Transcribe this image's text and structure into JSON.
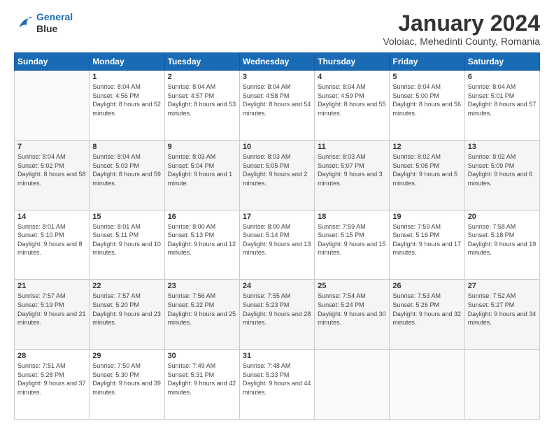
{
  "logo": {
    "line1": "General",
    "line2": "Blue"
  },
  "title": "January 2024",
  "location": "Voloiac, Mehedinti County, Romania",
  "days_header": [
    "Sunday",
    "Monday",
    "Tuesday",
    "Wednesday",
    "Thursday",
    "Friday",
    "Saturday"
  ],
  "weeks": [
    [
      {
        "num": "",
        "sunrise": "",
        "sunset": "",
        "daylight": ""
      },
      {
        "num": "1",
        "sunrise": "Sunrise: 8:04 AM",
        "sunset": "Sunset: 4:56 PM",
        "daylight": "Daylight: 8 hours and 52 minutes."
      },
      {
        "num": "2",
        "sunrise": "Sunrise: 8:04 AM",
        "sunset": "Sunset: 4:57 PM",
        "daylight": "Daylight: 8 hours and 53 minutes."
      },
      {
        "num": "3",
        "sunrise": "Sunrise: 8:04 AM",
        "sunset": "Sunset: 4:58 PM",
        "daylight": "Daylight: 8 hours and 54 minutes."
      },
      {
        "num": "4",
        "sunrise": "Sunrise: 8:04 AM",
        "sunset": "Sunset: 4:59 PM",
        "daylight": "Daylight: 8 hours and 55 minutes."
      },
      {
        "num": "5",
        "sunrise": "Sunrise: 8:04 AM",
        "sunset": "Sunset: 5:00 PM",
        "daylight": "Daylight: 8 hours and 56 minutes."
      },
      {
        "num": "6",
        "sunrise": "Sunrise: 8:04 AM",
        "sunset": "Sunset: 5:01 PM",
        "daylight": "Daylight: 8 hours and 57 minutes."
      }
    ],
    [
      {
        "num": "7",
        "sunrise": "Sunrise: 8:04 AM",
        "sunset": "Sunset: 5:02 PM",
        "daylight": "Daylight: 8 hours and 58 minutes."
      },
      {
        "num": "8",
        "sunrise": "Sunrise: 8:04 AM",
        "sunset": "Sunset: 5:03 PM",
        "daylight": "Daylight: 8 hours and 59 minutes."
      },
      {
        "num": "9",
        "sunrise": "Sunrise: 8:03 AM",
        "sunset": "Sunset: 5:04 PM",
        "daylight": "Daylight: 9 hours and 1 minute."
      },
      {
        "num": "10",
        "sunrise": "Sunrise: 8:03 AM",
        "sunset": "Sunset: 5:05 PM",
        "daylight": "Daylight: 9 hours and 2 minutes."
      },
      {
        "num": "11",
        "sunrise": "Sunrise: 8:03 AM",
        "sunset": "Sunset: 5:07 PM",
        "daylight": "Daylight: 9 hours and 3 minutes."
      },
      {
        "num": "12",
        "sunrise": "Sunrise: 8:02 AM",
        "sunset": "Sunset: 5:08 PM",
        "daylight": "Daylight: 9 hours and 5 minutes."
      },
      {
        "num": "13",
        "sunrise": "Sunrise: 8:02 AM",
        "sunset": "Sunset: 5:09 PM",
        "daylight": "Daylight: 9 hours and 6 minutes."
      }
    ],
    [
      {
        "num": "14",
        "sunrise": "Sunrise: 8:01 AM",
        "sunset": "Sunset: 5:10 PM",
        "daylight": "Daylight: 9 hours and 8 minutes."
      },
      {
        "num": "15",
        "sunrise": "Sunrise: 8:01 AM",
        "sunset": "Sunset: 5:11 PM",
        "daylight": "Daylight: 9 hours and 10 minutes."
      },
      {
        "num": "16",
        "sunrise": "Sunrise: 8:00 AM",
        "sunset": "Sunset: 5:13 PM",
        "daylight": "Daylight: 9 hours and 12 minutes."
      },
      {
        "num": "17",
        "sunrise": "Sunrise: 8:00 AM",
        "sunset": "Sunset: 5:14 PM",
        "daylight": "Daylight: 9 hours and 13 minutes."
      },
      {
        "num": "18",
        "sunrise": "Sunrise: 7:59 AM",
        "sunset": "Sunset: 5:15 PM",
        "daylight": "Daylight: 9 hours and 15 minutes."
      },
      {
        "num": "19",
        "sunrise": "Sunrise: 7:59 AM",
        "sunset": "Sunset: 5:16 PM",
        "daylight": "Daylight: 9 hours and 17 minutes."
      },
      {
        "num": "20",
        "sunrise": "Sunrise: 7:58 AM",
        "sunset": "Sunset: 5:18 PM",
        "daylight": "Daylight: 9 hours and 19 minutes."
      }
    ],
    [
      {
        "num": "21",
        "sunrise": "Sunrise: 7:57 AM",
        "sunset": "Sunset: 5:19 PM",
        "daylight": "Daylight: 9 hours and 21 minutes."
      },
      {
        "num": "22",
        "sunrise": "Sunrise: 7:57 AM",
        "sunset": "Sunset: 5:20 PM",
        "daylight": "Daylight: 9 hours and 23 minutes."
      },
      {
        "num": "23",
        "sunrise": "Sunrise: 7:56 AM",
        "sunset": "Sunset: 5:22 PM",
        "daylight": "Daylight: 9 hours and 25 minutes."
      },
      {
        "num": "24",
        "sunrise": "Sunrise: 7:55 AM",
        "sunset": "Sunset: 5:23 PM",
        "daylight": "Daylight: 9 hours and 28 minutes."
      },
      {
        "num": "25",
        "sunrise": "Sunrise: 7:54 AM",
        "sunset": "Sunset: 5:24 PM",
        "daylight": "Daylight: 9 hours and 30 minutes."
      },
      {
        "num": "26",
        "sunrise": "Sunrise: 7:53 AM",
        "sunset": "Sunset: 5:26 PM",
        "daylight": "Daylight: 9 hours and 32 minutes."
      },
      {
        "num": "27",
        "sunrise": "Sunrise: 7:52 AM",
        "sunset": "Sunset: 5:27 PM",
        "daylight": "Daylight: 9 hours and 34 minutes."
      }
    ],
    [
      {
        "num": "28",
        "sunrise": "Sunrise: 7:51 AM",
        "sunset": "Sunset: 5:28 PM",
        "daylight": "Daylight: 9 hours and 37 minutes."
      },
      {
        "num": "29",
        "sunrise": "Sunrise: 7:50 AM",
        "sunset": "Sunset: 5:30 PM",
        "daylight": "Daylight: 9 hours and 39 minutes."
      },
      {
        "num": "30",
        "sunrise": "Sunrise: 7:49 AM",
        "sunset": "Sunset: 5:31 PM",
        "daylight": "Daylight: 9 hours and 42 minutes."
      },
      {
        "num": "31",
        "sunrise": "Sunrise: 7:48 AM",
        "sunset": "Sunset: 5:33 PM",
        "daylight": "Daylight: 9 hours and 44 minutes."
      },
      {
        "num": "",
        "sunrise": "",
        "sunset": "",
        "daylight": ""
      },
      {
        "num": "",
        "sunrise": "",
        "sunset": "",
        "daylight": ""
      },
      {
        "num": "",
        "sunrise": "",
        "sunset": "",
        "daylight": ""
      }
    ]
  ]
}
